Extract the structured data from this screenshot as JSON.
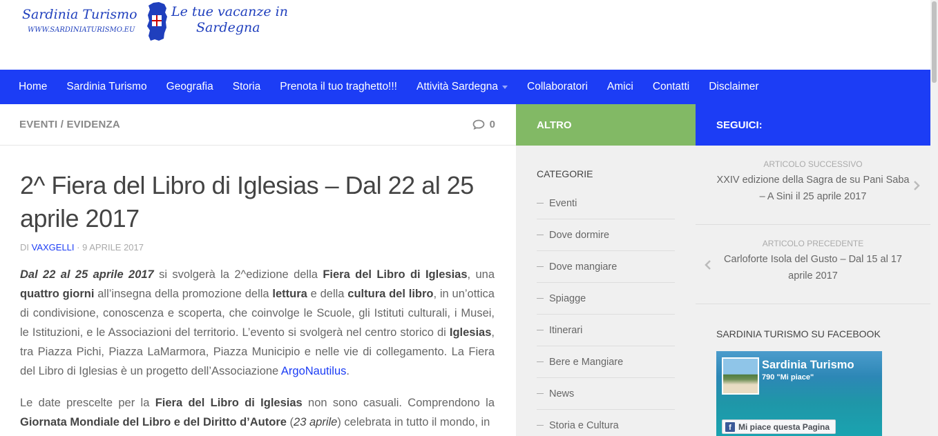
{
  "logo": {
    "name": "Sardinia Turismo",
    "url": "WWW.SARDINIATURISMO.EU",
    "tagline_line1": "Le tue vacanze in",
    "tagline_line2": "Sardegna"
  },
  "nav": {
    "items": [
      {
        "label": "Home"
      },
      {
        "label": "Sardinia Turismo"
      },
      {
        "label": "Geografia"
      },
      {
        "label": "Storia"
      },
      {
        "label": "Prenota il tuo traghetto!!!"
      },
      {
        "label": "Attività Sardegna",
        "dropdown": true
      },
      {
        "label": "Collaboratori"
      },
      {
        "label": "Amici"
      },
      {
        "label": "Contatti"
      },
      {
        "label": "Disclaimer"
      }
    ]
  },
  "breadcrumb": "EVENTI / EVIDENZA",
  "comments_count": "0",
  "post": {
    "title": "2^ Fiera del Libro di Iglesias – Dal 22 al 25 aprile 2017",
    "byline_prefix": "DI",
    "author": "VAXGELLI",
    "date": "· 9 APRILE 2017",
    "p1": {
      "s1": "Dal 22 al 25 aprile 2017",
      "s2": " si svolgerà la 2^edizione della ",
      "s3": "Fiera del Libro di Iglesias",
      "s4": ", una ",
      "s5": "quattro giorni",
      "s6": " all’insegna della promozione della ",
      "s7": "lettura",
      "s8": " e della ",
      "s9": "cultura del libro",
      "s10": ", in un’ottica di condivisione, conoscenza e scoperta, che coinvolge le Scuole, gli Istituti culturali, i Musei, le Istituzioni, e le Associazioni del territorio. L’evento si svolgerà nel centro storico di ",
      "s11": "Iglesias",
      "s12": ", tra Piazza Pichi, Piazza LaMarmora, Piazza Municipio e nelle vie di collegamento. La Fiera del Libro di Iglesias è un progetto dell’Associazione ",
      "s13": "ArgoNautilus",
      "s14": "."
    },
    "p2": {
      "s1": "Le date prescelte per la ",
      "s2": "Fiera del Libro di Iglesias",
      "s3": " non sono casuali. Comprendono la ",
      "s4": "Giornata Mondiale del Libro e del Diritto d’Autore",
      "s5": " (",
      "s6": "23 aprile",
      "s7": ") celebrata in tutto il mondo, in"
    }
  },
  "sidebar1": {
    "header": "ALTRO",
    "categories_title": "CATEGORIE",
    "categories": [
      "Eventi",
      "Dove dormire",
      "Dove mangiare",
      "Spiagge",
      "Itinerari",
      "Bere e Mangiare",
      "News",
      "Storia e Cultura"
    ]
  },
  "sidebar2": {
    "header": "SEGUICI:",
    "next_label": "ARTICOLO SUCCESSIVO",
    "next_title": "XXIV edizione della Sagra de su Pani Saba – A Sini il 25 aprile 2017",
    "prev_label": "ARTICOLO PRECEDENTE",
    "prev_title": "Carloforte Isola del Gusto – Dal 15 al 17 aprile 2017",
    "fb_title": "SARDINIA TURISMO SU FACEBOOK",
    "fb_page_name": "Sardinia Turismo",
    "fb_likes": "790 \"Mi piace\"",
    "fb_button": "Mi piace questa Pagina"
  },
  "colors": {
    "nav_bg": "#1c3df5",
    "altro_bg": "#82b965",
    "link": "#1c3df5"
  }
}
